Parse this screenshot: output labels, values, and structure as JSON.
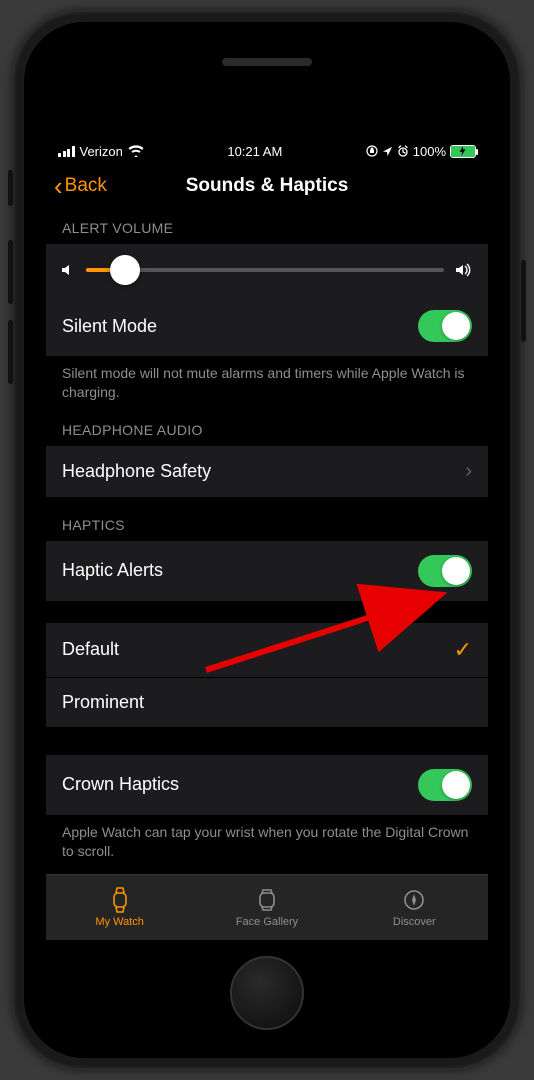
{
  "status": {
    "carrier": "Verizon",
    "time": "10:21 AM",
    "battery_percent": "100%"
  },
  "nav": {
    "back_label": "Back",
    "title": "Sounds & Haptics"
  },
  "sections": {
    "alert_volume": {
      "header": "ALERT VOLUME",
      "slider_percent": 11
    },
    "silent_mode": {
      "label": "Silent Mode",
      "footer": "Silent mode will not mute alarms and timers while Apple Watch is charging."
    },
    "headphone_audio": {
      "header": "HEADPHONE AUDIO",
      "safety_label": "Headphone Safety"
    },
    "haptics": {
      "header": "HAPTICS",
      "alerts_label": "Haptic Alerts",
      "default_label": "Default",
      "prominent_label": "Prominent"
    },
    "crown": {
      "label": "Crown Haptics",
      "footer": "Apple Watch can tap your wrist when you rotate the Digital Crown to scroll."
    }
  },
  "tabs": {
    "my_watch": "My Watch",
    "face_gallery": "Face Gallery",
    "discover": "Discover"
  }
}
